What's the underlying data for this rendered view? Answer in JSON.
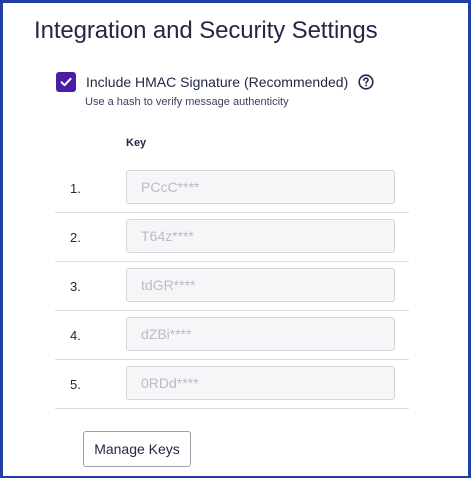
{
  "page": {
    "title": "Integration and Security Settings"
  },
  "hmac": {
    "checked": true,
    "label": "Include HMAC Signature (Recommended)",
    "description": "Use a hash to verify message authenticity",
    "help_icon": "question-circle-icon",
    "accent_color": "#4a1ca8"
  },
  "keys_table": {
    "header": "Key",
    "rows": [
      {
        "number": "1.",
        "value": "PCcC****"
      },
      {
        "number": "2.",
        "value": "T64z****"
      },
      {
        "number": "3.",
        "value": "tdGR****"
      },
      {
        "number": "4.",
        "value": "dZBi****"
      },
      {
        "number": "5.",
        "value": "0RDd****"
      }
    ]
  },
  "actions": {
    "manage_keys_label": "Manage Keys"
  },
  "colors": {
    "frame_border": "#1f3fa5",
    "text": "#232845",
    "input_background": "#f6f6f8",
    "input_text": "#b9bcc6"
  }
}
